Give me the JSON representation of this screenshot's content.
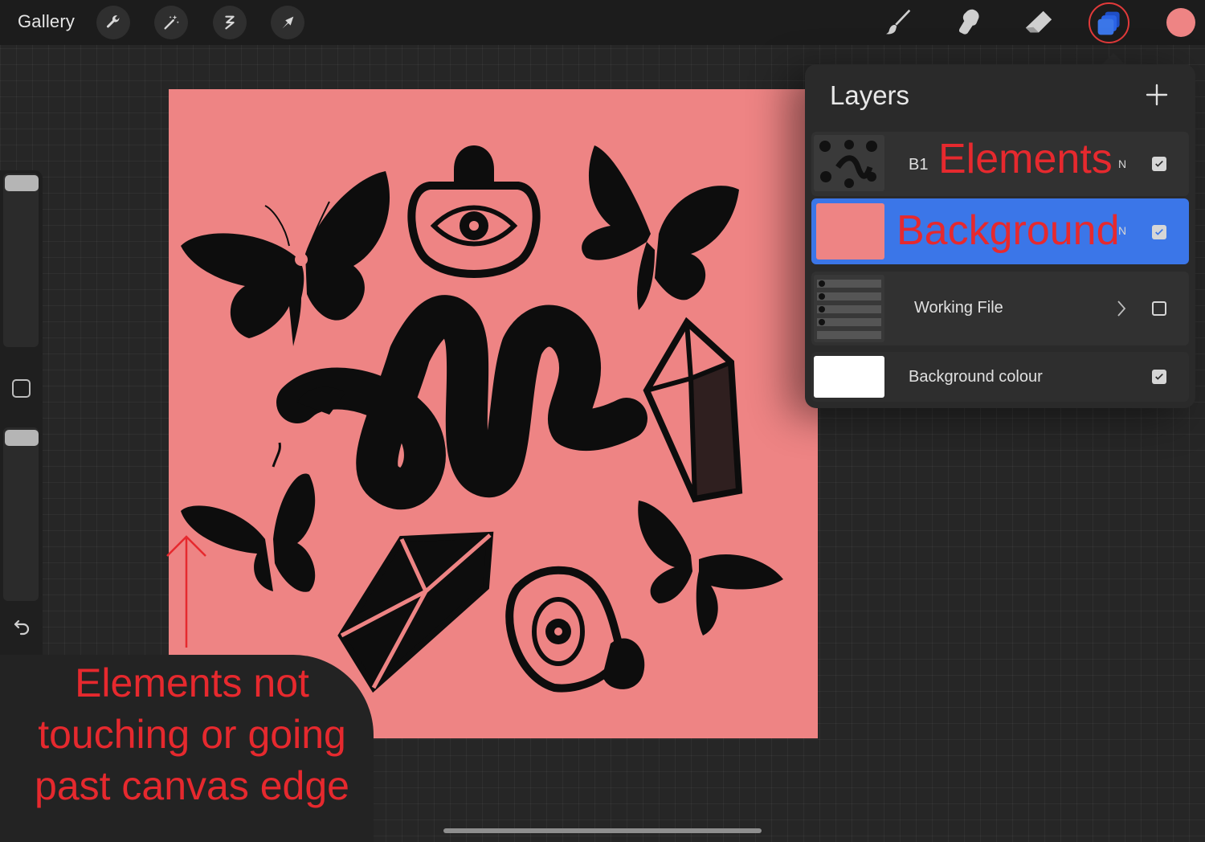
{
  "topbar": {
    "gallery_label": "Gallery",
    "left_tools": [
      "wrench-icon",
      "magic-wand-icon",
      "selection-icon",
      "transform-arrow-icon"
    ],
    "right_tools": [
      "brush-icon",
      "smudge-icon",
      "eraser-icon",
      "layers-icon"
    ],
    "current_color": "#ee8484",
    "accent_ring": "#e23a3a"
  },
  "canvas": {
    "background_color": "#ee8484",
    "elements": [
      "butterfly",
      "potion-bottle-eye",
      "butterfly",
      "snake",
      "crystal",
      "butterfly",
      "crystal",
      "eye-mushroom",
      "butterfly"
    ]
  },
  "layers": {
    "title": "Layers",
    "items": [
      {
        "prefix": "B1",
        "name": "Elements",
        "mode": "N",
        "visible": true
      },
      {
        "prefix": "",
        "name": "Background",
        "mode": "N",
        "visible": true,
        "active": true
      },
      {
        "prefix": "",
        "name": "Working File",
        "mode": "",
        "visible": false
      },
      {
        "prefix": "",
        "name": "Background colour",
        "mode": "",
        "visible": true
      }
    ]
  },
  "annotation": {
    "note": "Elements not touching or going past canvas edge",
    "color": "#e6292e"
  },
  "colors": {
    "selected_layer": "#3b76e8",
    "panel": "#2a2a2a",
    "topbar": "#1c1c1c"
  }
}
